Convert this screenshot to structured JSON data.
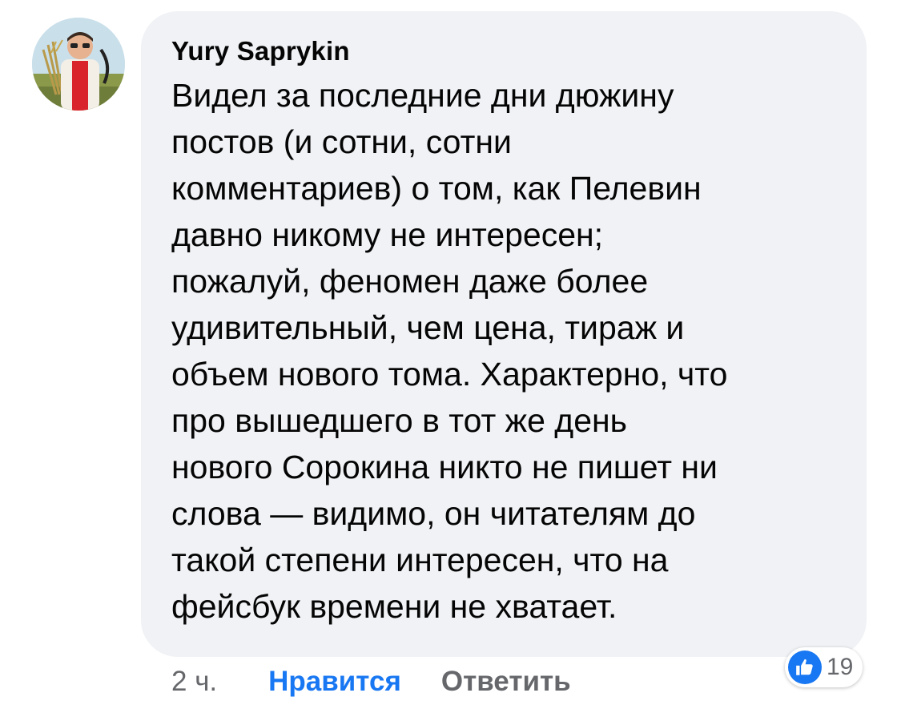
{
  "comment": {
    "author": "Yury Saprykin",
    "text_lines": [
      "Видел за последние дни дюжину",
      "постов (и сотни, сотни",
      "комментариев) о том, как Пелевин",
      "давно никому не интересен;",
      "пожалуй, феномен даже более",
      "удивительный, чем цена, тираж и",
      "объем нового тома. Характерно, что",
      "про вышедшего в тот же день",
      "нового Сорокина никто не пишет ни",
      "слова — видимо, он читателям до",
      "такой степени интересен, что на",
      "фейсбук времени не хватает."
    ],
    "time": "2 ч.",
    "like_label": "Нравится",
    "reply_label": "Ответить",
    "reaction_icon": "thumbs-up-icon",
    "reaction_count": "19"
  },
  "colors": {
    "bubble": "#f0f2f5",
    "accent": "#1877f2",
    "muted": "#65676b",
    "text": "#050505"
  }
}
